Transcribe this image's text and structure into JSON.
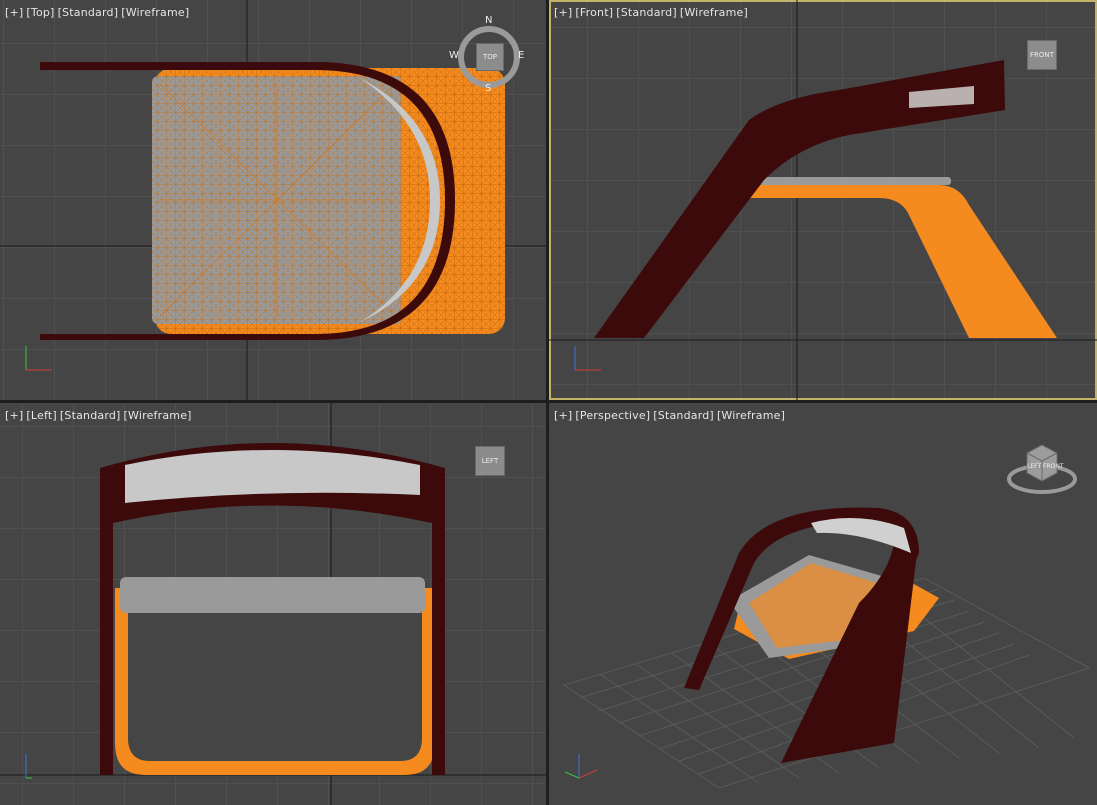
{
  "viewports": {
    "top": {
      "menu": "[+]",
      "view": "[Top]",
      "shading": "[Standard]",
      "mode": "[Wireframe]"
    },
    "front": {
      "menu": "[+]",
      "view": "[Front]",
      "shading": "[Standard]",
      "mode": "[Wireframe]"
    },
    "left": {
      "menu": "[+]",
      "view": "[Left]",
      "shading": "[Standard]",
      "mode": "[Wireframe]"
    },
    "persp": {
      "menu": "[+]",
      "view": "[Perspective]",
      "shading": "[Standard]",
      "mode": "[Wireframe]"
    }
  },
  "compass": {
    "n": "N",
    "e": "E",
    "s": "S",
    "w": "W"
  },
  "viewcube": {
    "top": "TOP",
    "front": "FRONT",
    "left": "LEFT",
    "persp_a": "LEFT",
    "persp_b": "FRONT"
  },
  "colors": {
    "grid_bg": "#454545",
    "seat_orange": "#f58a1f",
    "frame_dark": "#3c0a0a",
    "cushion_gray": "#a8a8a8",
    "active_border": "#c2b36a"
  }
}
